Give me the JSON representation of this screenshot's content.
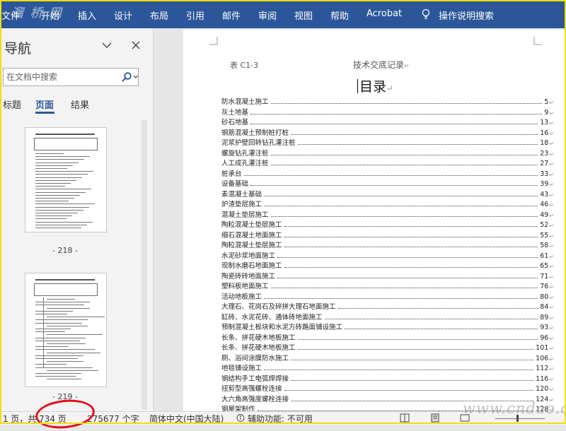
{
  "ribbon": {
    "tabs": [
      "文件",
      "开始",
      "插入",
      "设计",
      "布局",
      "引用",
      "邮件",
      "审阅",
      "视图",
      "帮助",
      "Acrobat"
    ],
    "tell_me": "操作说明搜索",
    "watermark": "溜 桥 网"
  },
  "nav_pane": {
    "title": "导航",
    "search_placeholder": "在文档中搜索",
    "tabs": [
      "标题",
      "页面",
      "结果"
    ],
    "active_tab": "页面",
    "thumbnails": [
      {
        "label": "- 218 -"
      },
      {
        "label": "- 219 -"
      }
    ]
  },
  "document": {
    "header_left": "表 C1-3",
    "header_center": "技术交底记录",
    "title": "目录",
    "toc": [
      {
        "title": "防水混凝土施工",
        "page": "5"
      },
      {
        "title": "灰土地基",
        "page": "9"
      },
      {
        "title": "砂石地基",
        "page": "13"
      },
      {
        "title": "钢筋混凝土预制桩打桩",
        "page": "16"
      },
      {
        "title": "泥浆护壁回转钻孔灌注桩",
        "page": "18"
      },
      {
        "title": "螺旋钻孔灌注桩",
        "page": "23"
      },
      {
        "title": "人工成孔灌注桩",
        "page": "27"
      },
      {
        "title": "桩承台",
        "page": "33"
      },
      {
        "title": "设备基础",
        "page": "39"
      },
      {
        "title": "素混凝土基础",
        "page": "43"
      },
      {
        "title": "炉渣垫层施工",
        "page": "46"
      },
      {
        "title": "混凝土垫层施工",
        "page": "49"
      },
      {
        "title": "陶粒混凝土垫层施工",
        "page": "52"
      },
      {
        "title": "细石混凝土地面施工",
        "page": "55"
      },
      {
        "title": "陶粒混凝土垫层施工",
        "page": "58"
      },
      {
        "title": "水泥砂浆地面施工",
        "page": "61"
      },
      {
        "title": "现制水磨石地面施工",
        "page": "65"
      },
      {
        "title": "陶瓷砖砖地面施工",
        "page": "71"
      },
      {
        "title": "塑料板地面施工",
        "page": "76"
      },
      {
        "title": "活动地板施工",
        "page": "80"
      },
      {
        "title": "大理石、花岗石及碎拼大理石地面施工",
        "page": "84"
      },
      {
        "title": "缸砖、水泥花砖、通体砖地面施工",
        "page": "89"
      },
      {
        "title": "预制混凝土板块和水泥方砖路面铺设施工",
        "page": "93"
      },
      {
        "title": "长条、拼花硬木地板施工",
        "page": "96"
      },
      {
        "title": "长条、拼花硬木地板施工",
        "page": "101"
      },
      {
        "title": "厕、浴间涂膜防水施工",
        "page": "106"
      },
      {
        "title": "地毯铺设施工",
        "page": "112"
      },
      {
        "title": "钢结构手工电弧焊焊接",
        "page": "116"
      },
      {
        "title": "扭剪型高强螺栓连接",
        "page": "120"
      },
      {
        "title": "大六角高强度螺栓连接",
        "page": "124"
      },
      {
        "title": "钢屋架制作",
        "page": "128"
      }
    ]
  },
  "status_bar": {
    "page_info": "第 1 页，共 734 页",
    "word_count": "275677 个字",
    "language": "简体中文(中国大陆)",
    "accessibility": "辅助功能: 不可用"
  },
  "site_watermark": "www.cndao.com",
  "colors": {
    "ribbon": "#2b579a",
    "accent": "#2b579a",
    "annotation": "#e0101a",
    "frame": "#f0e000"
  }
}
